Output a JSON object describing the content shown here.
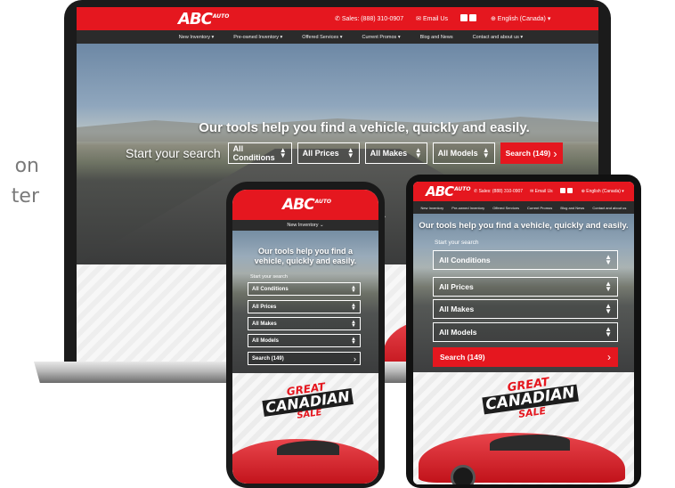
{
  "side_text": [
    "on",
    "ter"
  ],
  "brand": {
    "logo_main": "ABC",
    "logo_sub": "AUTO",
    "accent": "#e5171f",
    "dark": "#2b2b2b"
  },
  "laptop": {
    "header": {
      "phone": "Sales: (888) 310-0907",
      "email": "Email Us",
      "language": "English (Canada)"
    },
    "nav": [
      "New Inventory",
      "Pre-owned Inventory",
      "Offered Services",
      "Current Promos",
      "Blog and News",
      "Contact and about us"
    ],
    "hero": {
      "title": "Our tools help you find a vehicle, quickly and easily.",
      "search_label": "Start your search",
      "selects": [
        "All Conditions",
        "All Prices",
        "All Makes",
        "All Models"
      ],
      "search_button": "Search (149)"
    }
  },
  "tablet": {
    "header": {
      "phone": "Sales: (888) 310-0907",
      "email": "Email Us",
      "language": "English (Canada)"
    },
    "nav": [
      "New Inventory",
      "Pre-owned Inventory",
      "Offered Services",
      "Current Promos",
      "Blog and News",
      "Contact and about us"
    ],
    "hero": {
      "title": "Our tools help you find a vehicle, quickly and easily.",
      "search_label": "Start your search",
      "selects": [
        "All Conditions",
        "All Prices",
        "All Makes",
        "All Models"
      ],
      "search_button": "Search (149)"
    },
    "sale": {
      "line1": "GREAT",
      "line2": "CANADIAN",
      "line3": "SALE"
    }
  },
  "phone": {
    "nav": "New Inventory",
    "hero": {
      "title": "Our tools help you find a vehicle, quickly and easily.",
      "search_label": "Start your search",
      "selects": [
        "All Conditions",
        "All Prices",
        "All Makes",
        "All Models"
      ],
      "search_button": "Search (149)"
    },
    "sale": {
      "line1": "GREAT",
      "line2": "CANADIAN",
      "line3": "SALE"
    }
  },
  "icons": {
    "phone": "phone-icon",
    "email": "envelope-icon",
    "globe": "globe-icon",
    "chevron": "chevron-right-icon",
    "select_arrows": "sort-arrows-icon",
    "chevron_down": "chevron-down-icon"
  }
}
